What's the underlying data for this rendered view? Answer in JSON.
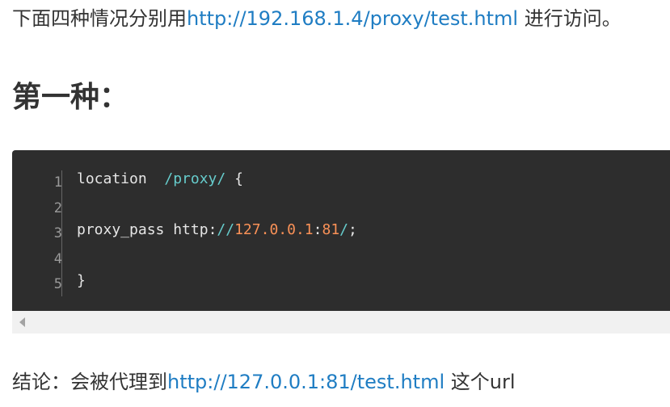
{
  "intro": {
    "prefix": "下面四种情况分别用",
    "link": "http://192.168.1.4/proxy/test.html",
    "suffix": " 进行访问。"
  },
  "heading": "第一种：",
  "code": {
    "line_numbers": [
      "1",
      "2",
      "3",
      "4",
      "5"
    ],
    "line1": {
      "keyword": "location  ",
      "path": "/proxy/",
      "brace": " {"
    },
    "line3": {
      "directive": "proxy_pass http",
      "colon": ":",
      "slashes": "//",
      "ip": "127.0.0.1",
      "colon2": ":",
      "port": "81",
      "slash": "/",
      "semicolon": ";"
    },
    "line5": "}"
  },
  "conclusion": {
    "prefix": "结论：会被代理到",
    "link": "http://127.0.0.1:81/test.html",
    "suffix": " 这个url"
  }
}
